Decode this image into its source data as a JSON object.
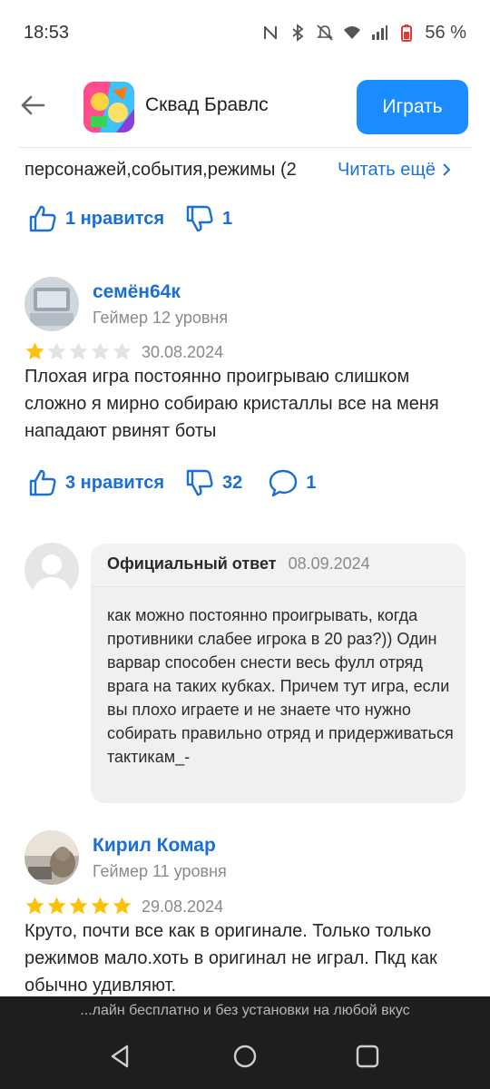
{
  "status_bar": {
    "time": "18:53",
    "battery": "56 %",
    "icons": [
      "nfc-icon",
      "bluetooth-icon",
      "mute-icon",
      "wifi-icon",
      "signal-icon",
      "battery-icon"
    ]
  },
  "header": {
    "app_title": "Сквад Бравлс",
    "play_label": "Играть"
  },
  "review0": {
    "partial_line": "персонажей,события,режимы (2",
    "read_more": "Читать ещё",
    "likes": "1 нравится",
    "dislikes": "1"
  },
  "review1": {
    "username": "семён64к",
    "level": "Геймер 12 уровня",
    "rating": 1,
    "date": "30.08.2024",
    "text": "Плохая игра постоянно проигрываю слишком сложно я мирно собираю кристаллы все на меня нападают рвинят боты",
    "likes": "3 нравится",
    "dislikes": "32",
    "comments": "1"
  },
  "official_reply": {
    "label": "Официальный ответ",
    "date": "08.09.2024",
    "text": "как можно постоянно проигрывать, когда противники слабее игрока в 20 раз?)) Один варвар способен снести весь фулл отряд врага на таких кубках. Причем тут игра, если вы плохо играете и не знаете что нужно собирать правильно отряд и придерживаться тактикам_-"
  },
  "review2": {
    "username": "Кирил Комар",
    "level": "Геймер 11 уровня",
    "rating": 5,
    "date": "29.08.2024",
    "text": "Круто, почти все как в оригинале. Только только режимов мало.хоть в оригинал не играл. Пкд как обычно удивляют."
  },
  "bottom_banner": "...лайн бесплатно и без установки на любой вкус",
  "colors": {
    "accent": "#1a8cff",
    "link": "#1a6fd6",
    "star": "#ffc107"
  }
}
